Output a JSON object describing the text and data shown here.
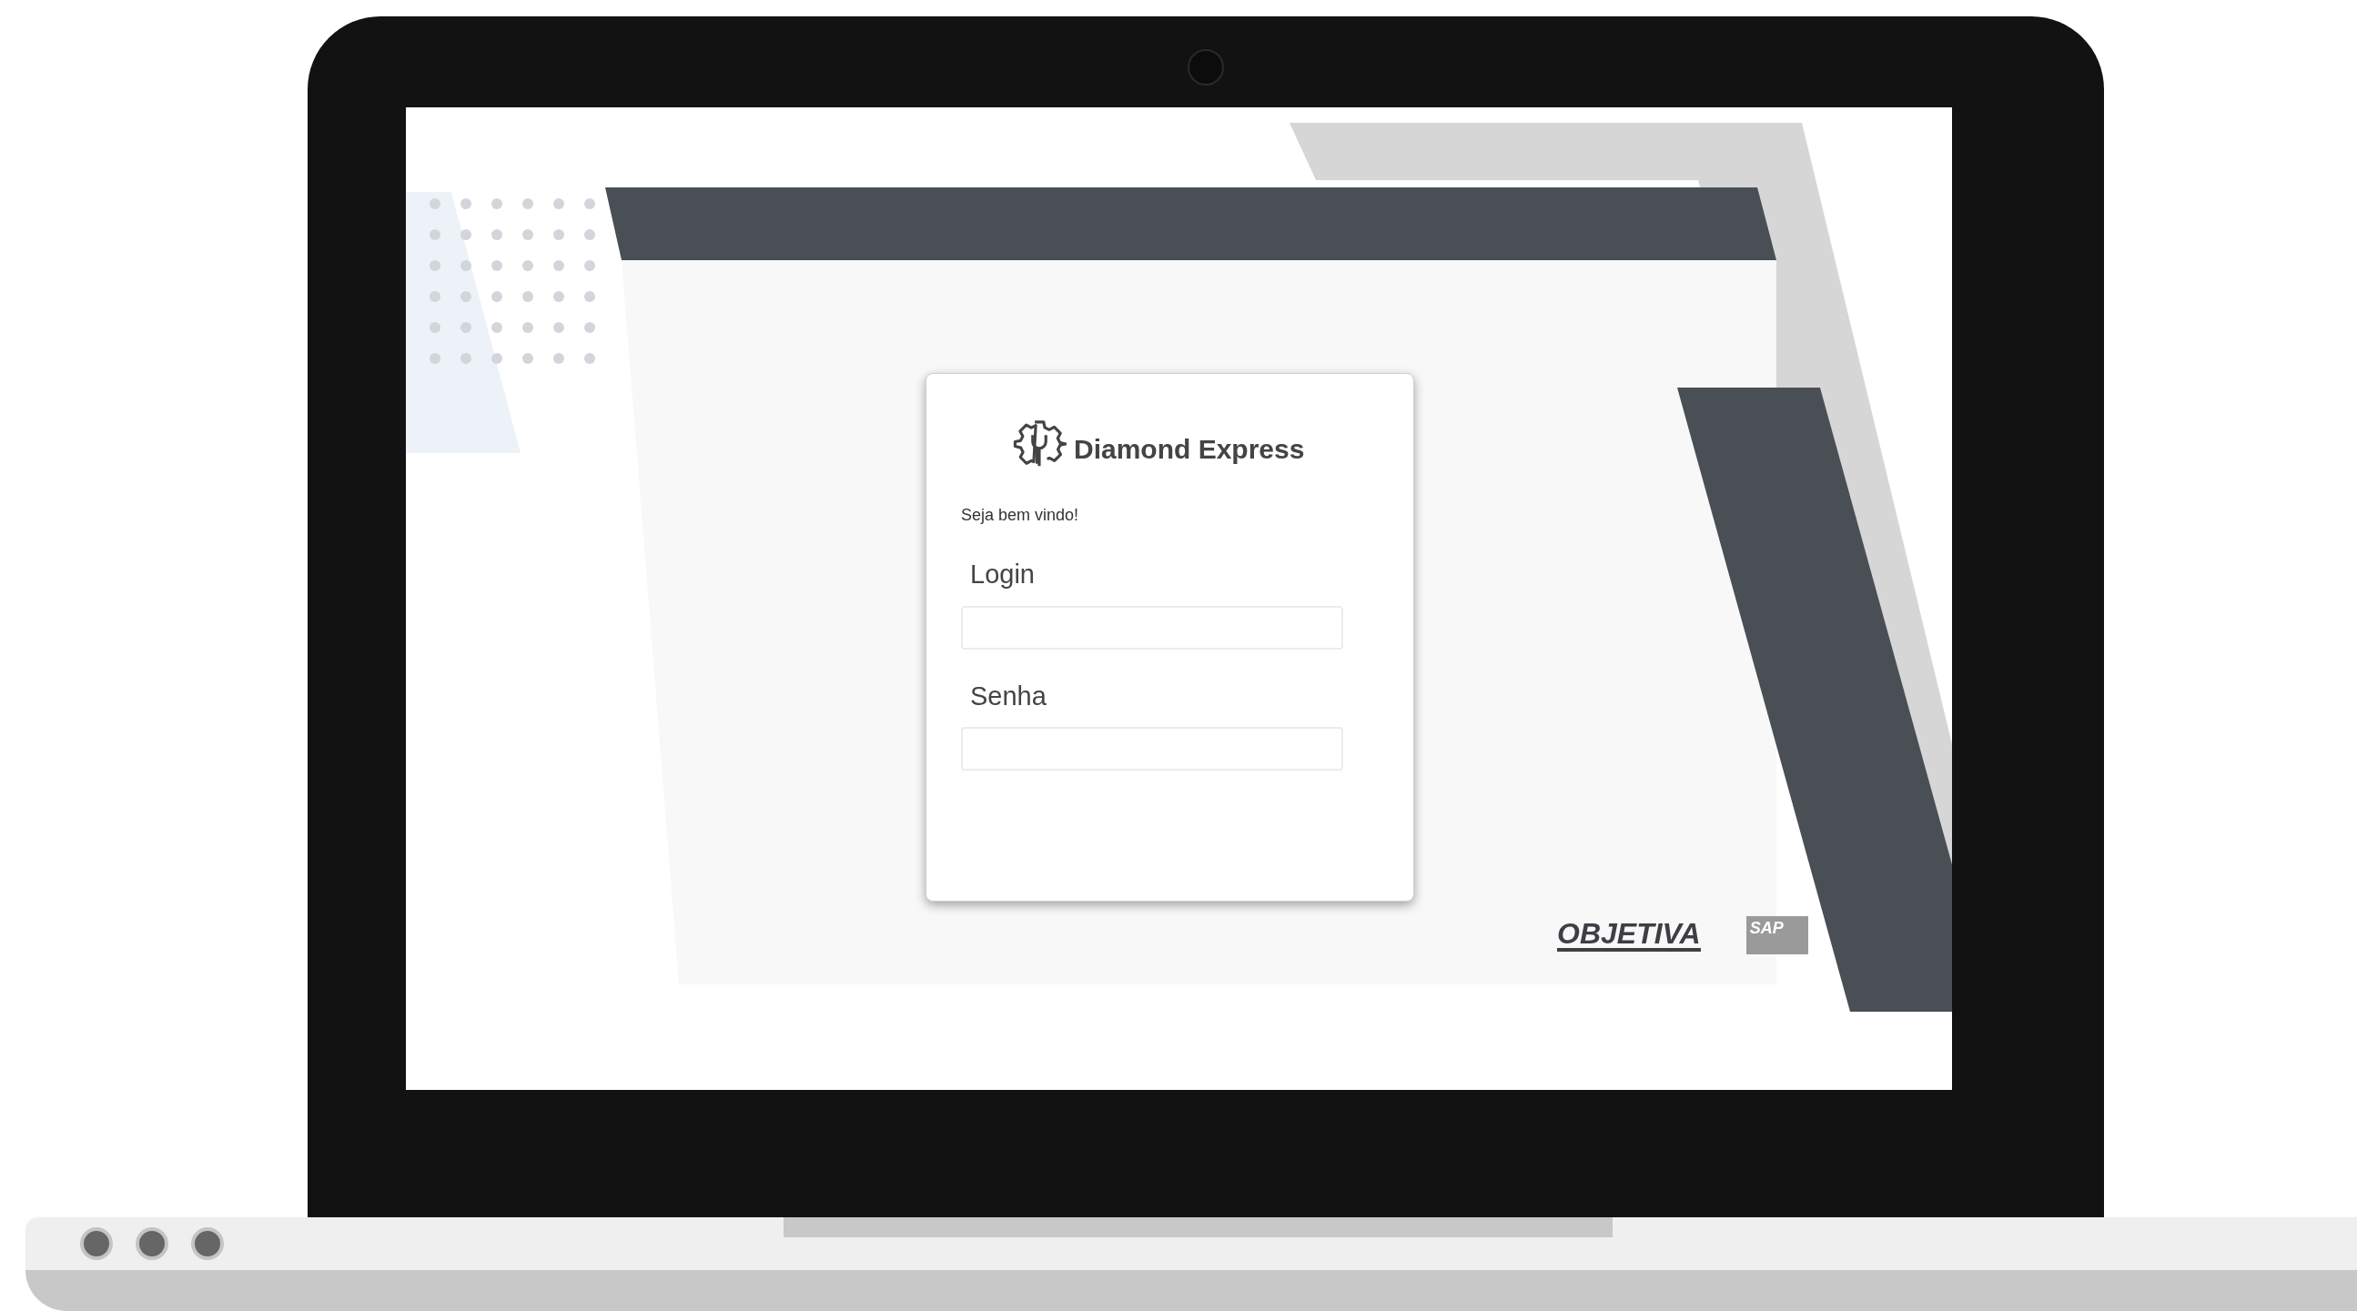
{
  "login_card": {
    "brand": "Diamond Express",
    "welcome": "Seja bem vindo!",
    "fields": [
      {
        "label": "Login"
      },
      {
        "label": "Senha"
      }
    ]
  },
  "footer_logos": {
    "objetiva": "OBJETIVA",
    "sap": "SAP"
  }
}
